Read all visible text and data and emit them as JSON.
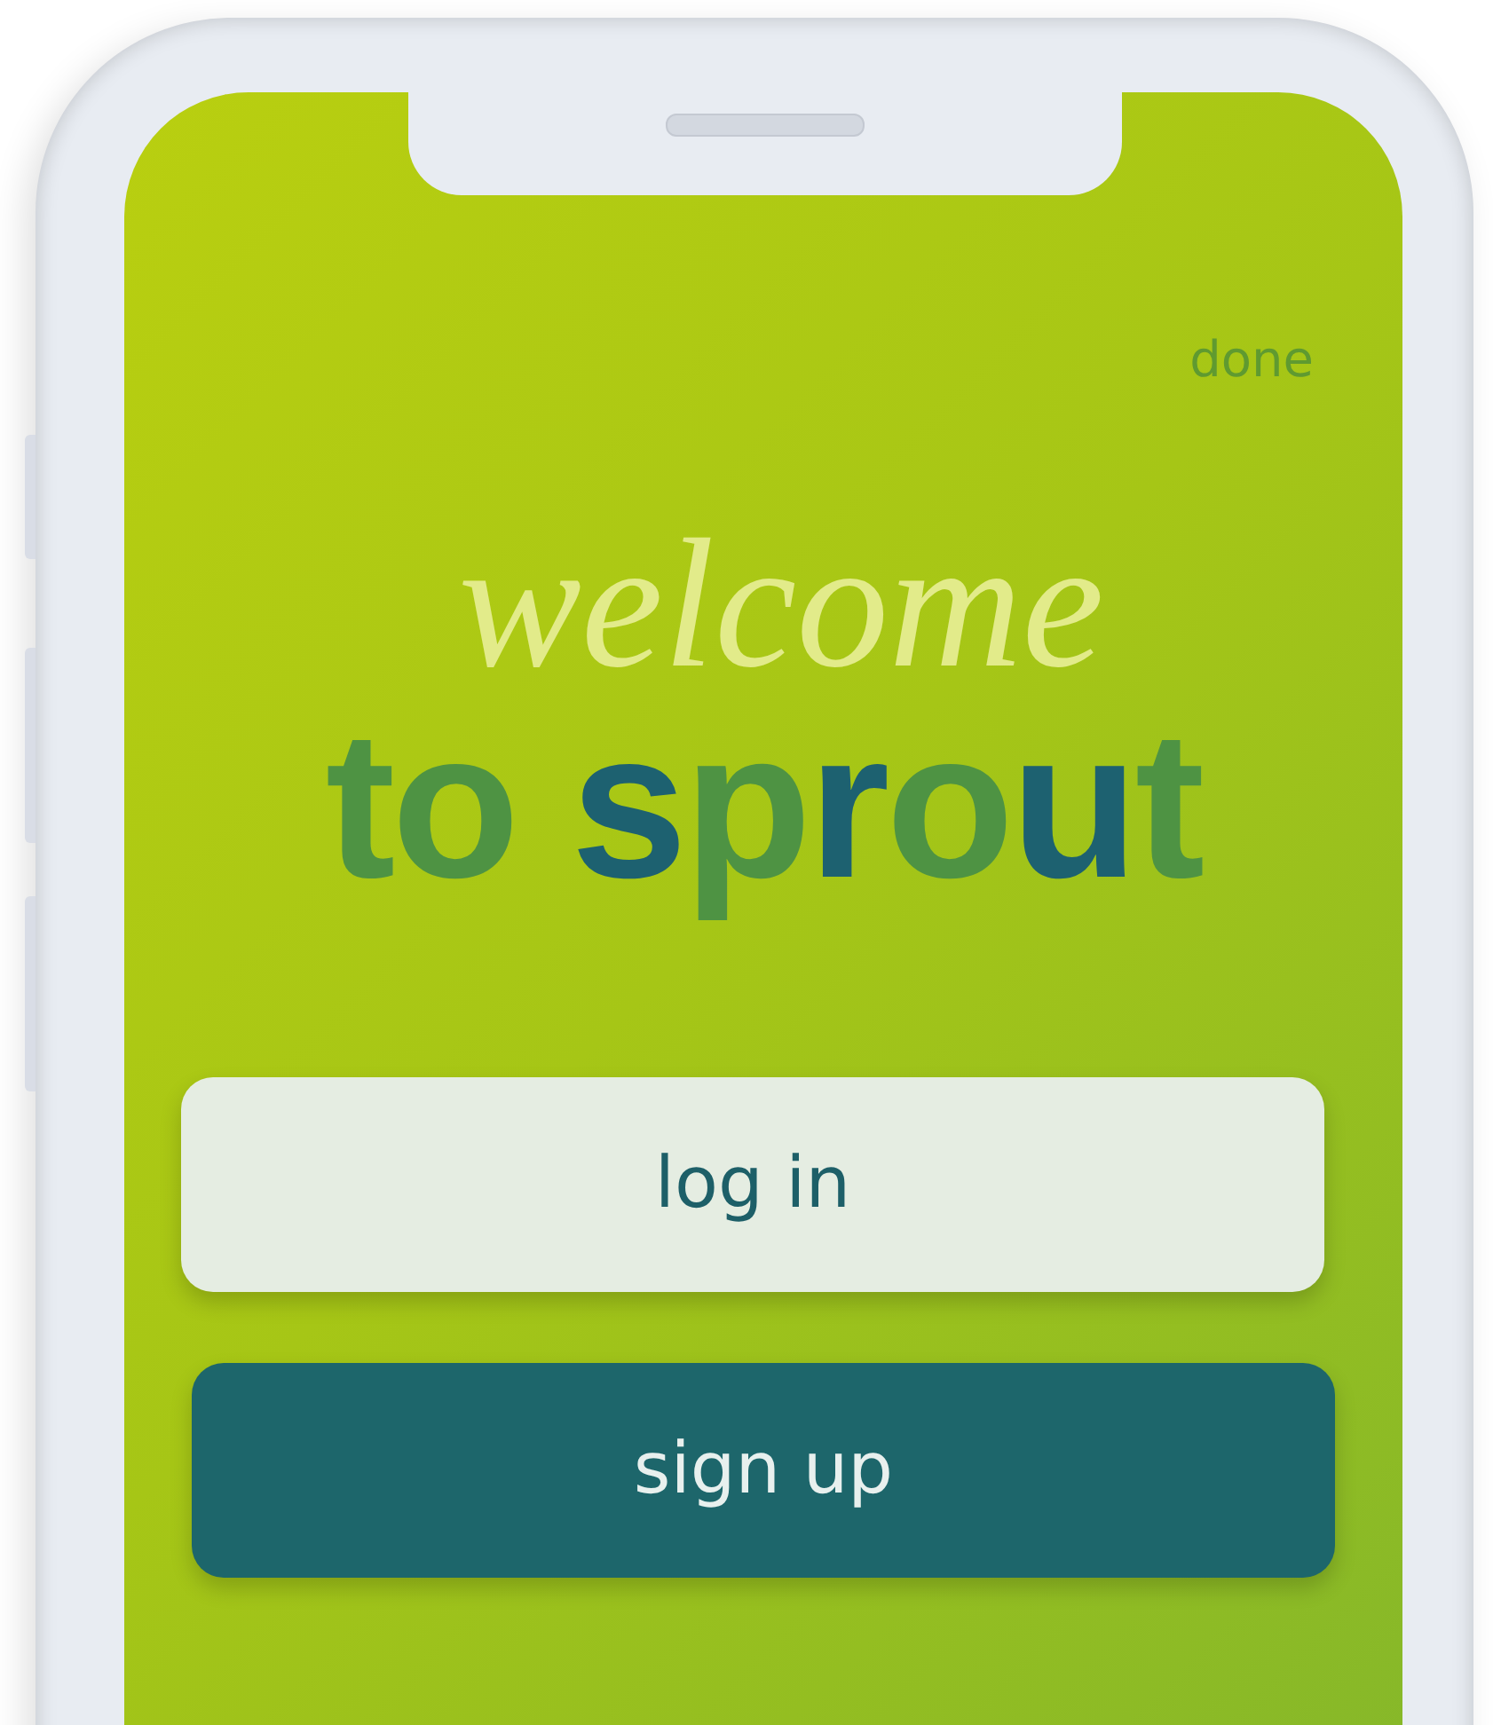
{
  "top_action": "done",
  "greeting": "welcome",
  "title": [
    {
      "text": "to ",
      "color": "#4e9343"
    },
    {
      "text": "s",
      "color": "#1d6170"
    },
    {
      "text": "p",
      "color": "#4e9343"
    },
    {
      "text": "r",
      "color": "#1d6170"
    },
    {
      "text": "o",
      "color": "#4e9343"
    },
    {
      "text": "u",
      "color": "#1d6170"
    },
    {
      "text": "t",
      "color": "#4e9343"
    }
  ],
  "buttons": [
    {
      "label": "log in",
      "kind": "secondary"
    },
    {
      "label": "sign up",
      "kind": "primary"
    }
  ]
}
